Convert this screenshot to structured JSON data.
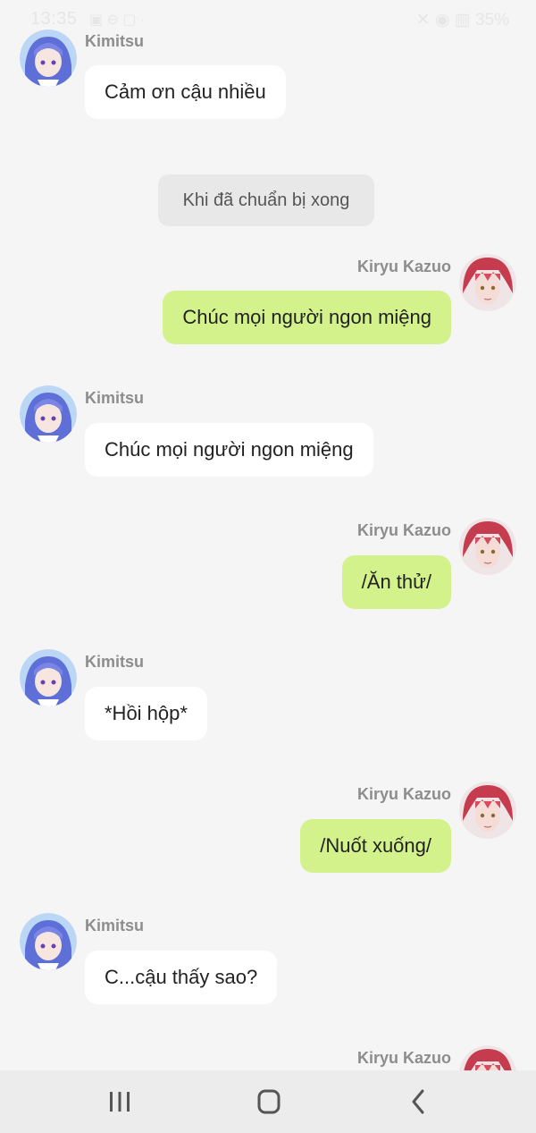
{
  "status_bar": {
    "time": "13:35",
    "left_icons": "▣ ⊖ ▢ ·",
    "right_icons": "✕ ◉ ▥",
    "battery": "35%"
  },
  "participants": {
    "left_name": "Kimitsu",
    "right_name": "Kiryu Kazuo"
  },
  "messages": [
    {
      "side": "left",
      "name": "Kimitsu",
      "text": "Cảm ơn cậu nhiều"
    },
    {
      "side": "system",
      "text": "Khi đã chuẩn bị xong"
    },
    {
      "side": "right",
      "name": "Kiryu Kazuo",
      "text": "Chúc mọi người ngon miệng"
    },
    {
      "side": "left",
      "name": "Kimitsu",
      "text": "Chúc mọi người ngon miệng"
    },
    {
      "side": "right",
      "name": "Kiryu Kazuo",
      "text": "/Ăn thử/"
    },
    {
      "side": "left",
      "name": "Kimitsu",
      "text": "*Hồi hộp*"
    },
    {
      "side": "right",
      "name": "Kiryu Kazuo",
      "text": "/Nuốt xuống/"
    },
    {
      "side": "left",
      "name": "Kimitsu",
      "text": "C...cậu thấy sao?"
    },
    {
      "side": "right",
      "name": "Kiryu Kazuo",
      "text": ""
    }
  ],
  "nav": {
    "recent_icon": "recent-apps-icon",
    "home_icon": "home-icon",
    "back_icon": "back-icon"
  },
  "colors": {
    "background": "#f5f5f5",
    "left_bubble": "#ffffff",
    "right_bubble": "#d4f28c",
    "system_bubble": "#e8e8e8",
    "name": "#8d8d8d"
  }
}
